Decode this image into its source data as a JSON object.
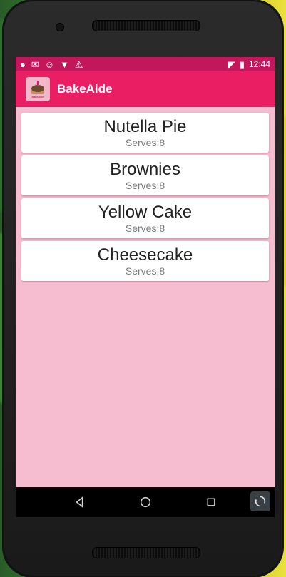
{
  "statusbar": {
    "time": "12:44",
    "left_icons": [
      "hangouts-icon",
      "gmail-icon",
      "face-icon",
      "bull-icon",
      "warning-icon"
    ],
    "right_icons": [
      "signal-lte-icon",
      "battery-icon"
    ]
  },
  "app": {
    "title": "BakeAide",
    "logo_text": "BakeAide"
  },
  "recipes": [
    {
      "name": "Nutella Pie",
      "serves": "Serves:8"
    },
    {
      "name": "Brownies",
      "serves": "Serves:8"
    },
    {
      "name": "Yellow Cake",
      "serves": "Serves:8"
    },
    {
      "name": "Cheesecake",
      "serves": "Serves:8"
    }
  ],
  "navbar": {
    "buttons": [
      "back-icon",
      "home-icon",
      "recents-icon"
    ]
  },
  "colors": {
    "status_bar": "#c2185b",
    "toolbar": "#e91e63",
    "content_bg": "#f6bcd0"
  }
}
